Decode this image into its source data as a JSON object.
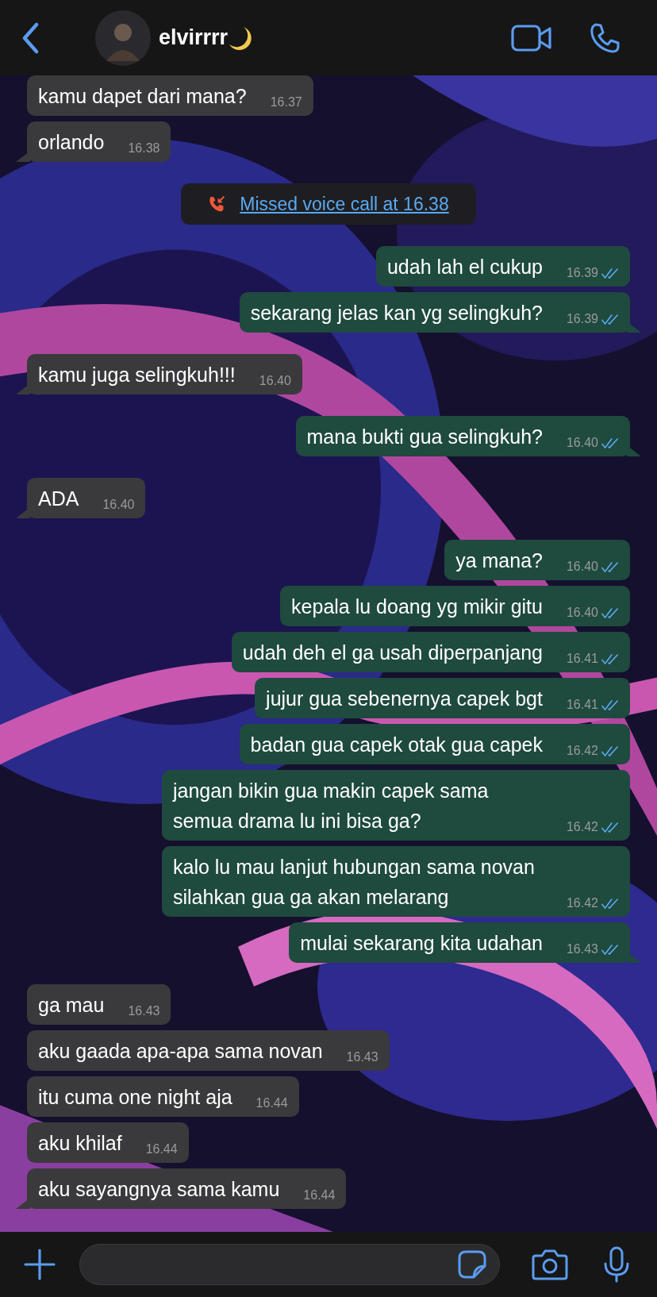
{
  "header": {
    "contact_name": "elvirrrr"
  },
  "messages": [
    {
      "kind": "incoming",
      "text": "kamu dapet dari mana?",
      "time": "16.37",
      "tail": false
    },
    {
      "kind": "incoming",
      "text": "orlando",
      "time": "16.38",
      "tail": true
    },
    {
      "kind": "call",
      "text": "Missed voice call at 16.38"
    },
    {
      "kind": "outgoing",
      "text": "udah lah el cukup",
      "time": "16.39",
      "tail": false,
      "read": true
    },
    {
      "kind": "outgoing",
      "text": "sekarang jelas kan yg selingkuh?",
      "time": "16.39",
      "tail": true,
      "read": true
    },
    {
      "kind": "incoming",
      "text": "kamu juga selingkuh!!!",
      "time": "16.40",
      "tail": true
    },
    {
      "kind": "outgoing",
      "text": "mana bukti gua selingkuh?",
      "time": "16.40",
      "tail": true,
      "read": true
    },
    {
      "kind": "incoming",
      "text": "ADA",
      "time": "16.40",
      "tail": true
    },
    {
      "kind": "outgoing",
      "text": "ya mana?",
      "time": "16.40",
      "tail": false,
      "read": true
    },
    {
      "kind": "outgoing",
      "text": "kepala lu doang yg mikir gitu",
      "time": "16.40",
      "tail": false,
      "read": true
    },
    {
      "kind": "outgoing",
      "text": "udah deh el ga usah diperpanjang",
      "time": "16.41",
      "tail": false,
      "read": true
    },
    {
      "kind": "outgoing",
      "text": "jujur gua sebenernya capek bgt",
      "time": "16.41",
      "tail": false,
      "read": true
    },
    {
      "kind": "outgoing",
      "text": "badan gua capek otak gua capek",
      "time": "16.42",
      "tail": false,
      "read": true
    },
    {
      "kind": "outgoing",
      "text": "jangan bikin gua makin capek sama semua drama lu ini bisa ga?",
      "time": "16.42",
      "tail": false,
      "read": true
    },
    {
      "kind": "outgoing",
      "text": "kalo lu mau lanjut hubungan sama novan silahkan gua ga akan melarang",
      "time": "16.42",
      "tail": false,
      "read": true
    },
    {
      "kind": "outgoing",
      "text": "mulai sekarang kita udahan",
      "time": "16.43",
      "tail": true,
      "read": true
    },
    {
      "kind": "incoming",
      "text": "ga mau",
      "time": "16.43",
      "tail": false
    },
    {
      "kind": "incoming",
      "text": "aku gaada apa-apa sama novan",
      "time": "16.43",
      "tail": false
    },
    {
      "kind": "incoming",
      "text": "itu cuma one night aja",
      "time": "16.44",
      "tail": false
    },
    {
      "kind": "incoming",
      "text": "aku khilaf",
      "time": "16.44",
      "tail": false
    },
    {
      "kind": "incoming",
      "text": "aku sayangnya sama kamu",
      "time": "16.44",
      "tail": true
    }
  ]
}
